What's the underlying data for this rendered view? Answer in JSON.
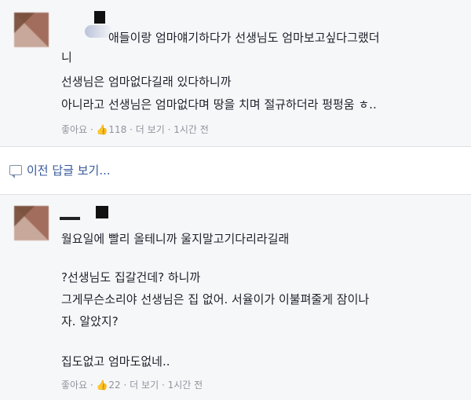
{
  "comments": [
    {
      "lines": [
        "애들이랑 엄마얘기하다가 선생님도 엄마보고싶다그랬더",
        "니",
        "선생님은 엄마없다길래 있다하니까",
        "아니라고 선생님은 엄마없다며 땅을 치며 절규하더라 펑펑움 ㅎ.."
      ],
      "like_label": "좋아요",
      "like_count": "118",
      "more_label": "더 보기",
      "time": "1시간 전"
    },
    {
      "lines": [
        "월요일에 빨리 올테니까 울지말고기다리라길래",
        "?선생님도 집갈건데? 하니까",
        "그게무슨소리야 선생님은 집 없어. 서율이가 이불펴줄게 잠이나",
        "자. 알았지?",
        "집도없고 엄마도없네.."
      ],
      "like_label": "좋아요",
      "like_count": "22",
      "more_label": "더 보기",
      "time": "1시간 전"
    }
  ],
  "prev_replies_label": "이전 답글 보기..."
}
